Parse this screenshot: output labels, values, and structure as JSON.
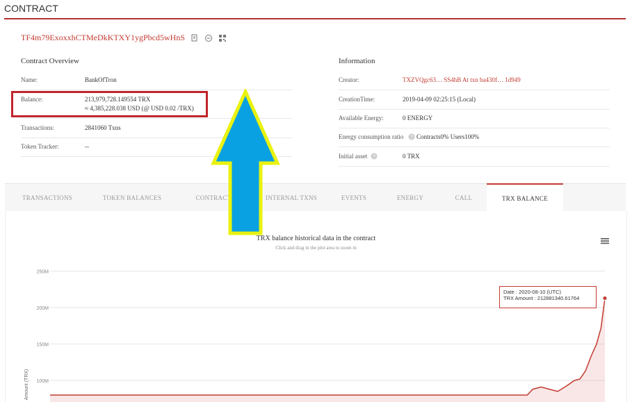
{
  "header": {
    "title": "CONTRACT"
  },
  "contract": {
    "address": "TF4m79ExoxxhCTMeDkKTXY1ygPbcd5wHnS"
  },
  "overview": {
    "title": "Contract Overview",
    "name_label": "Name:",
    "name_value": "BankOfTron",
    "balance_label": "Balance:",
    "balance_trx": "213,979,728.149554 TRX",
    "balance_usd": "≈ 4,385,228.038 USD (@ USD 0.02 /TRX)",
    "transactions_label": "Transactions:",
    "transactions_value": "2841060  Txns",
    "token_tracker_label": "Token Tracker:",
    "token_tracker_value": "--"
  },
  "information": {
    "title": "Information",
    "creator_label": "Creator:",
    "creator_value": "TXZVQgc63…  SS4hB  At txn ba430f…  1d949",
    "creation_time_label": "CreationTime:",
    "creation_time_value": "2019-04-09 02:25:15 (Local)",
    "energy_label": "Available Energy:",
    "energy_value": "0  ENERGY",
    "ratio_label": "Energy consumption ratio",
    "ratio_value": "Contracts0%  Users100%",
    "initial_asset_label": "Initial asset",
    "initial_asset_value": "0 TRX"
  },
  "tabs": [
    {
      "label": "TRANSACTIONS"
    },
    {
      "label": "TOKEN BALANCES"
    },
    {
      "label": "CONTRACT"
    },
    {
      "label": "INTERNAL TXNS"
    },
    {
      "label": "EVENTS"
    },
    {
      "label": "ENERGY"
    },
    {
      "label": "CALL"
    },
    {
      "label": "TRX BALANCE"
    }
  ],
  "active_tab": "TRX BALANCE",
  "colors": {
    "accent": "#c23a2f",
    "arrow_fill": "#0aa1e2",
    "arrow_stroke": "#e9f20f",
    "box": "#c0262c"
  },
  "chart_data": {
    "type": "area",
    "title": "TRX balance historical data in the contract",
    "subtitle": "Click and drag in the plot area to zoom in",
    "ylabel": "Amount  (TRX)",
    "y_ticks": [
      "100M",
      "150M",
      "200M",
      "250M"
    ],
    "ylim": [
      90000000,
      250000000
    ],
    "grid": true,
    "series": [
      {
        "color": "#c23a2f",
        "points": [
          {
            "x": 0.0,
            "y": 80000000
          },
          {
            "x": 0.86,
            "y": 80000000
          },
          {
            "x": 0.87,
            "y": 88000000
          },
          {
            "x": 0.885,
            "y": 91000000
          },
          {
            "x": 0.9,
            "y": 88000000
          },
          {
            "x": 0.915,
            "y": 85000000
          },
          {
            "x": 0.93,
            "y": 92000000
          },
          {
            "x": 0.945,
            "y": 100000000
          },
          {
            "x": 0.955,
            "y": 102000000
          },
          {
            "x": 0.965,
            "y": 113000000
          },
          {
            "x": 0.975,
            "y": 133000000
          },
          {
            "x": 0.985,
            "y": 150000000
          },
          {
            "x": 0.993,
            "y": 172000000
          },
          {
            "x": 1.0,
            "y": 212881340.61764
          }
        ]
      }
    ],
    "tooltip": {
      "date_line": "Date : 2020-08-10 (UTC)",
      "amount_line": "TRX Amount : 212881340.61764"
    }
  }
}
